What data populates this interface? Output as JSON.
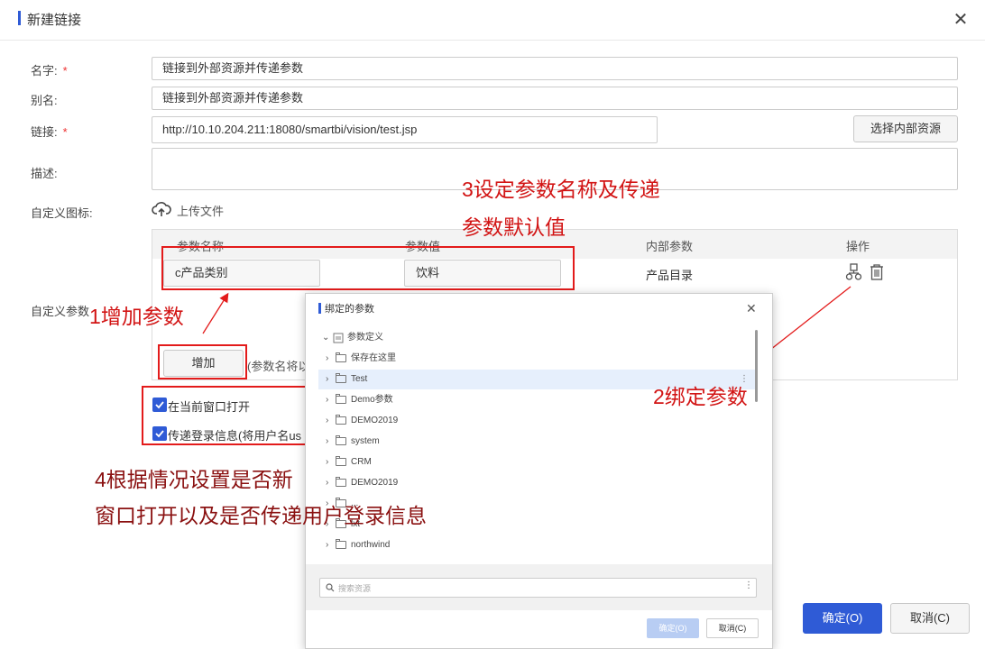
{
  "window": {
    "title": "新建链接"
  },
  "form": {
    "name_label": "名字:",
    "name_value": "链接到外部资源并传递参数",
    "alias_label": "别名:",
    "alias_value": "链接到外部资源并传递参数",
    "link_label": "链接:",
    "link_value": "http://10.10.204.211:18080/smartbi/vision/test.jsp",
    "choose_internal_button": "选择内部资源",
    "desc_label": "描述:",
    "icon_label": "自定义图标:",
    "upload_label": "上传文件",
    "params_label": "自定义参数",
    "required_mark": "*"
  },
  "param_table": {
    "columns": [
      "参数名称",
      "参数值",
      "内部参数",
      "操作"
    ],
    "rows": [
      {
        "name": "c产品类别",
        "value": "饮料",
        "internal": "产品目录"
      }
    ],
    "add_button": "增加",
    "hint_partial": "(参数名将以"
  },
  "checkboxes": [
    {
      "label": "在当前窗口打开",
      "checked": true
    },
    {
      "label": "传递登录信息(将用户名us",
      "checked": true
    }
  ],
  "footer": {
    "ok": "确定(O)",
    "cancel": "取消(C)"
  },
  "annotations": {
    "step1": "1增加参数",
    "step2": "2绑定参数",
    "step3_line1": "3设定参数名称及传递",
    "step3_line2": "参数默认值",
    "step4_line1": "4根据情况设置是否新",
    "step4_line2": "窗口打开以及是否传递用户登录信息"
  },
  "bind_dialog": {
    "title": "绑定的参数",
    "root": "参数定义",
    "items": [
      "保存在这里",
      "Test",
      "Demo参数",
      "DEMO2019",
      "system",
      "CRM",
      "DEMO2019",
      "...",
      "lxt",
      "northwind"
    ],
    "selected_index": 1,
    "search_placeholder": "搜索资源",
    "ok": "确定(O)",
    "cancel": "取消(C)"
  },
  "colors": {
    "accent": "#2f5bd6",
    "annotation": "#e31b1b"
  }
}
